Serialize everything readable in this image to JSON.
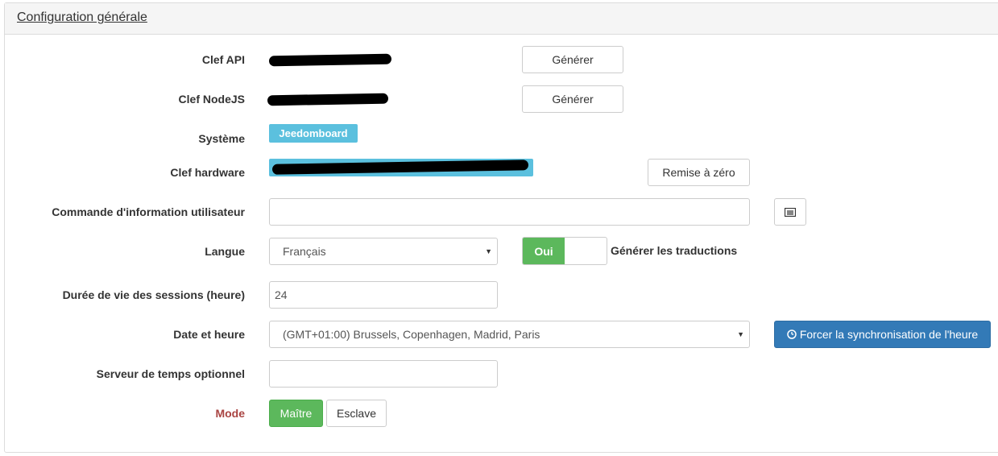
{
  "panel": {
    "title": "Configuration générale"
  },
  "rows": {
    "api_key": {
      "label": "Clef API",
      "button": "Générer"
    },
    "nodejs_key": {
      "label": "Clef NodeJS",
      "button": "Générer"
    },
    "system": {
      "label": "Système",
      "badge": "Jeedomboard"
    },
    "hardware_key": {
      "label": "Clef hardware",
      "button": "Remise à zéro"
    },
    "user_info_cmd": {
      "label": "Commande d'information utilisateur",
      "value": ""
    },
    "language": {
      "label": "Langue",
      "selected": "Français",
      "toggle_on": "Oui",
      "toggle_label": "Générer les traductions"
    },
    "session": {
      "label": "Durée de vie des sessions (heure)",
      "value": "24"
    },
    "datetime": {
      "label": "Date et heure",
      "selected": "(GMT+01:00) Brussels, Copenhagen, Madrid, Paris",
      "button": "Forcer la synchronisation de l'heure"
    },
    "time_server": {
      "label": "Serveur de temps optionnel",
      "value": ""
    },
    "mode": {
      "label": "Mode",
      "master": "Maître",
      "slave": "Esclave"
    }
  },
  "colors": {
    "primary": "#337ab7",
    "success": "#5cb85c",
    "info": "#5bc0de",
    "danger_label": "#a94442"
  }
}
